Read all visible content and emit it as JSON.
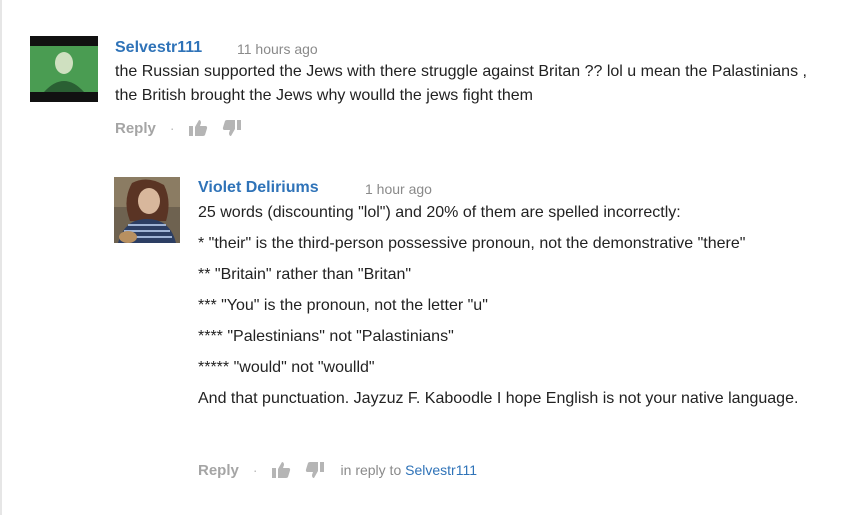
{
  "comments": [
    {
      "author": "Selvestr111",
      "time": "11 hours ago",
      "text": "the Russian supported the Jews with there struggle against Britan ?? lol u mean the Palastinians , the British brought the Jews why woulld the jews fight them",
      "reply_label": "Reply",
      "separator": "·"
    },
    {
      "author": "Violet Deliriums",
      "time": "1 hour ago",
      "lines": [
        "25 words (discounting \"lol\") and 20% of them are spelled incorrectly:",
        "* \"their\" is the third-person possessive pronoun, not the demonstrative \"there\"",
        "** \"Britain\" rather than \"Britan\"",
        "*** \"You\" is the pronoun, not the letter \"u\"",
        "**** \"Palestinians\" not \"Palastinians\"",
        "***** \"would\" not \"woulld\"",
        "And that punctuation. Jayzuz F. Kaboodle I hope English is not your native language."
      ],
      "reply_label": "Reply",
      "separator": "·",
      "in_reply_prefix": "in reply to",
      "in_reply_user": "Selvestr111"
    }
  ],
  "icons": [
    "thumbs-up-icon",
    "thumbs-down-icon"
  ],
  "colors": {
    "author_link": "#2f73b8",
    "meta_gray": "#8a8a8a",
    "action_gray": "#a5a5a5"
  }
}
